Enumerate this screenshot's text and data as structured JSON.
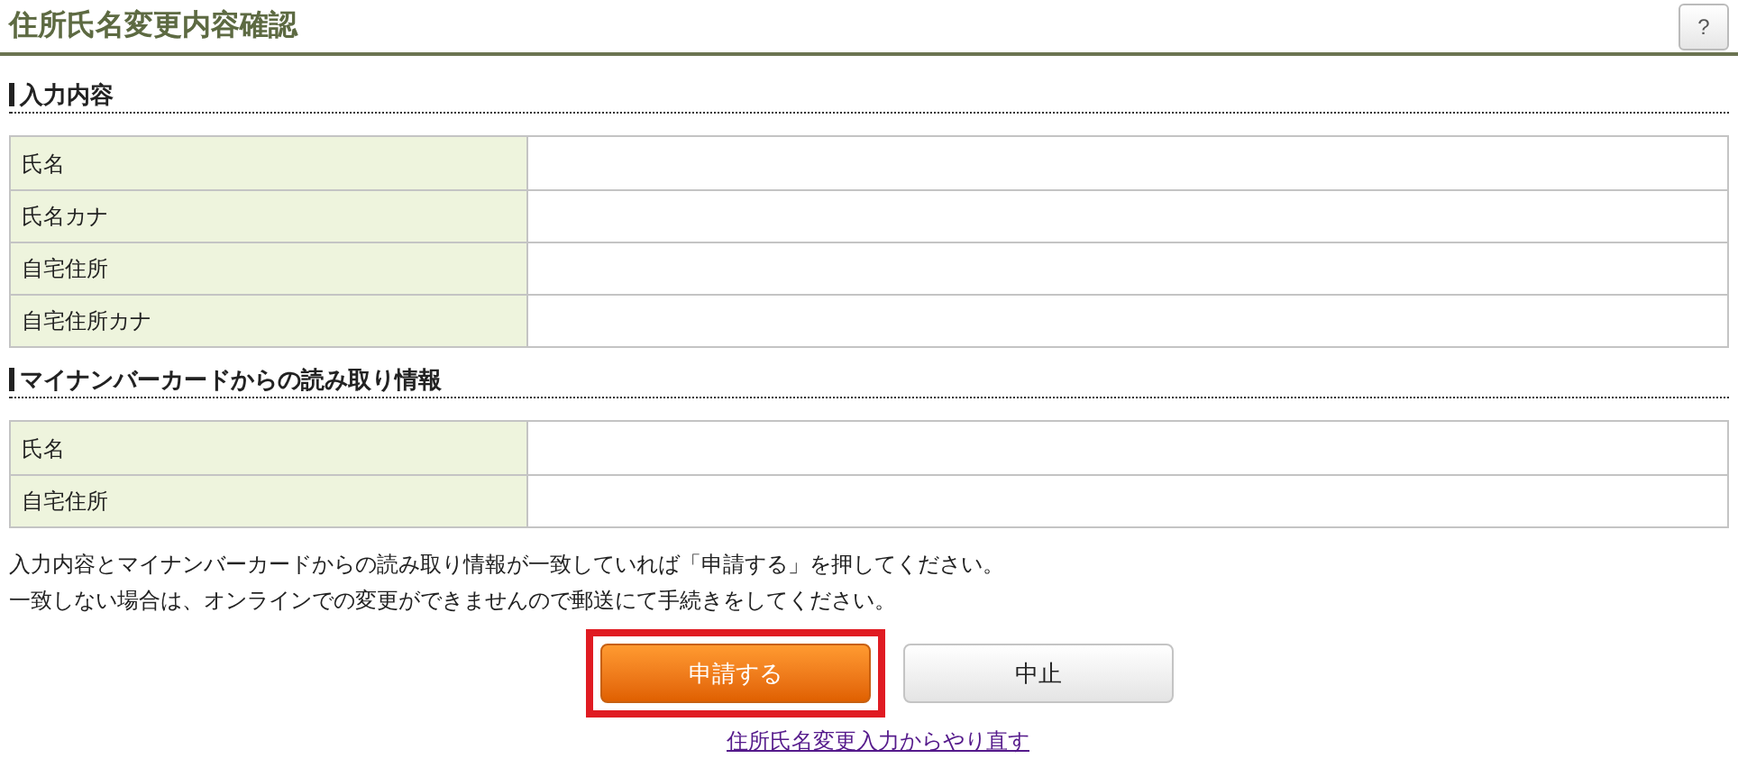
{
  "page_title": "住所氏名変更内容確認",
  "help_button": {
    "label": "?"
  },
  "sections": [
    {
      "heading": "入力内容",
      "rows": [
        {
          "label": "氏名"
        },
        {
          "label": "氏名カナ"
        },
        {
          "label": "自宅住所"
        },
        {
          "label": "自宅住所カナ"
        }
      ]
    },
    {
      "heading": "マイナンバーカードからの読み取り情報",
      "rows": [
        {
          "label": "氏名"
        },
        {
          "label": "自宅住所"
        }
      ]
    }
  ],
  "instructions": [
    "入力内容とマイナンバーカードからの読み取り情報が一致していれば「申請する」を押してください。",
    "一致しない場合は、オンラインでの変更ができませんので郵送にて手続きをしてください。"
  ],
  "buttons": [
    {
      "label": "申請する",
      "kind": "primary",
      "highlighted": true
    },
    {
      "label": "中止",
      "kind": "secondary",
      "highlighted": false
    }
  ],
  "link": "住所氏名変更入力からやり直す"
}
